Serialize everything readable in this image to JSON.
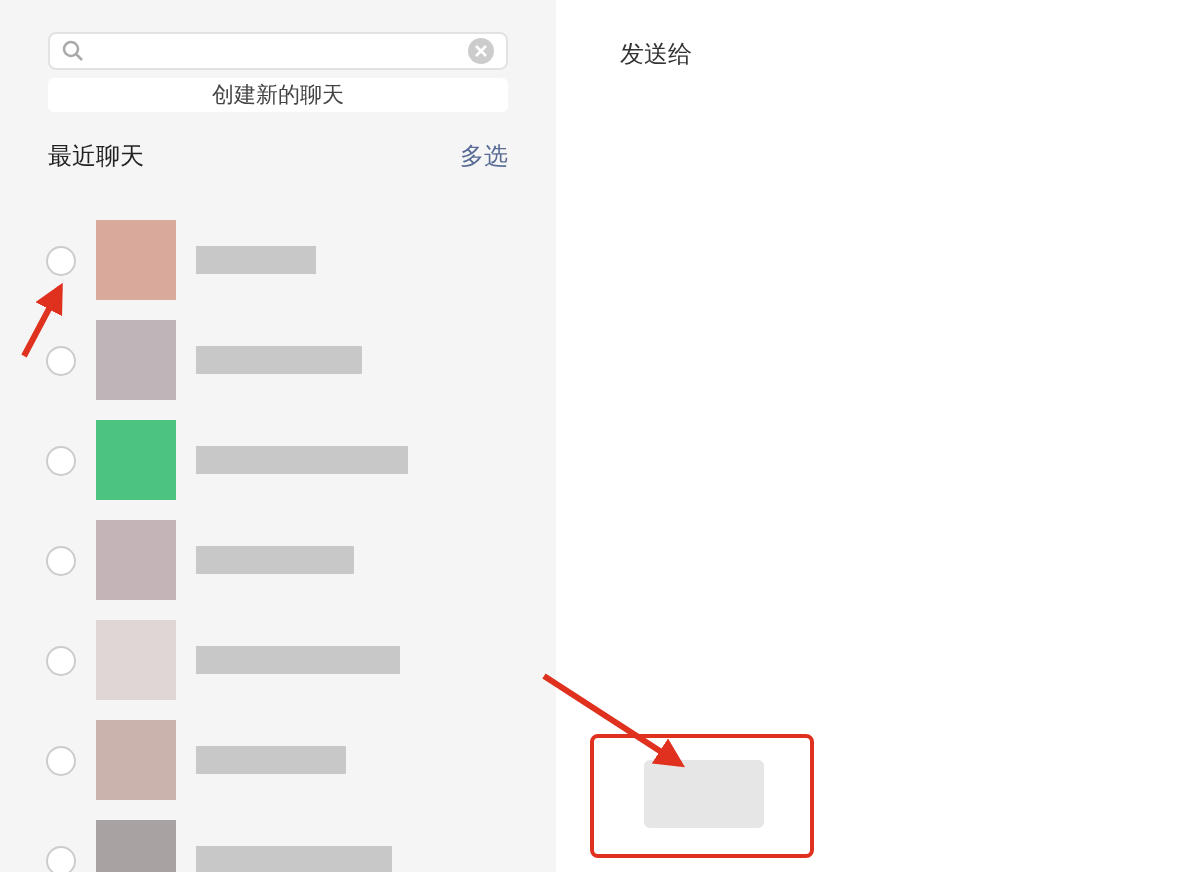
{
  "sidebar": {
    "new_chat_button": "创建新的聊天",
    "section_title": "最近聊天",
    "multi_select": "多选",
    "contacts": [
      {
        "selected": false,
        "color": "#d9a99c"
      },
      {
        "selected": false,
        "color": "#bdb5b8"
      },
      {
        "selected": false,
        "color": "#4cc47f"
      },
      {
        "selected": false,
        "color": "#c4b4b8"
      },
      {
        "selected": false,
        "color": "#e0d6d6"
      },
      {
        "selected": false,
        "color": "#c9b3ac"
      },
      {
        "selected": false,
        "color": "#a9a2a2"
      }
    ]
  },
  "main": {
    "title": "发送给"
  },
  "annotations": [
    {
      "kind": "arrow"
    },
    {
      "kind": "arrow"
    },
    {
      "kind": "highlight"
    }
  ]
}
